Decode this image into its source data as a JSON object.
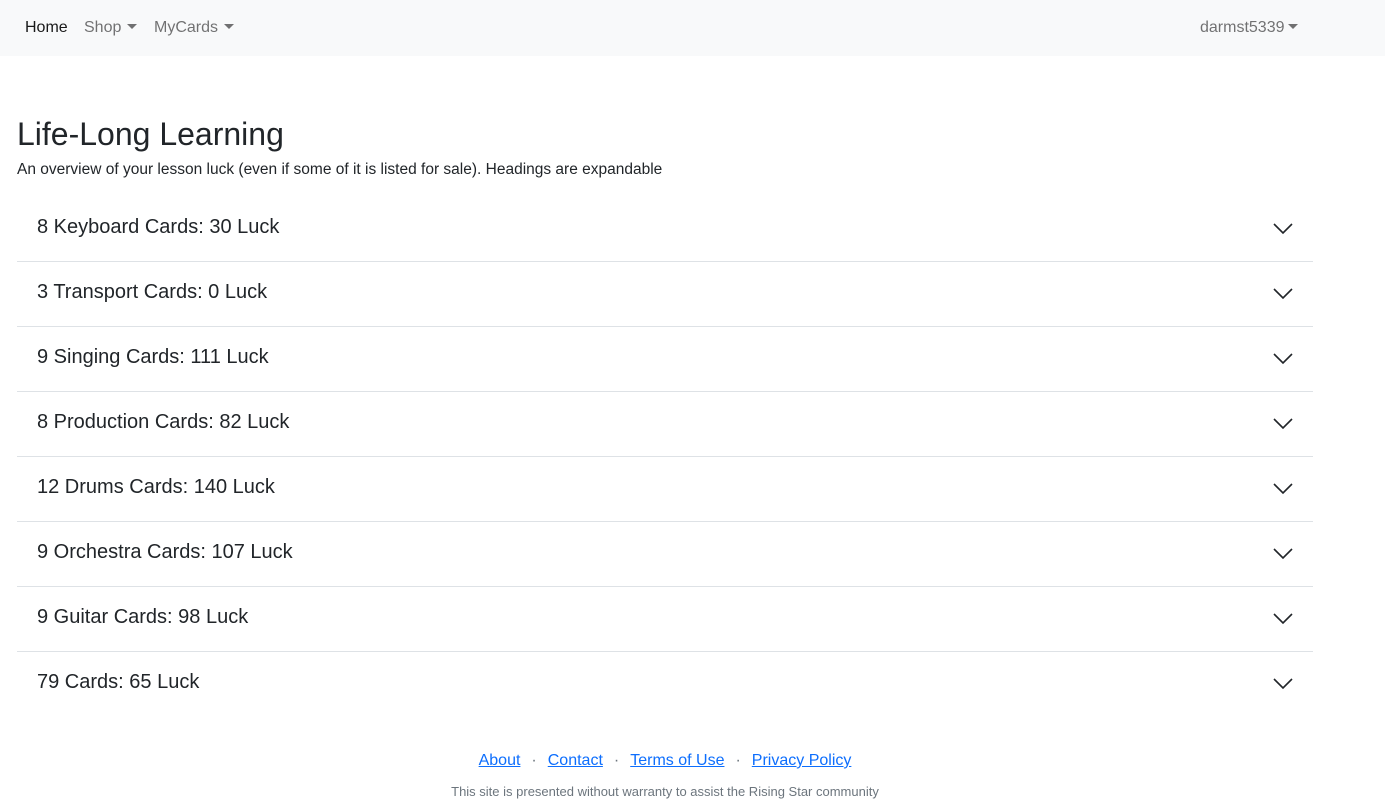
{
  "navbar": {
    "home_label": "Home",
    "shop_label": "Shop",
    "mycards_label": "MyCards",
    "user_label": "darmst5339"
  },
  "page": {
    "title": "Life-Long Learning",
    "subtitle": "An overview of your lesson luck (even if some of it is listed for sale). Headings are expandable"
  },
  "accordion": {
    "items": [
      {
        "label": "8 Keyboard Cards: 30 Luck"
      },
      {
        "label": "3 Transport Cards: 0 Luck"
      },
      {
        "label": "9 Singing Cards: 111 Luck"
      },
      {
        "label": "8 Production Cards: 82 Luck"
      },
      {
        "label": "12 Drums Cards: 140 Luck"
      },
      {
        "label": "9 Orchestra Cards: 107 Luck"
      },
      {
        "label": "9 Guitar Cards: 98 Luck"
      },
      {
        "label": "79 Cards: 65 Luck"
      }
    ],
    "expand_icon": "chevron-down-icon"
  },
  "footer": {
    "about": "About",
    "contact": "Contact",
    "terms": "Terms of Use",
    "privacy": "Privacy Policy",
    "separator": "·",
    "note": "This site is presented without warranty to assist the Rising Star community"
  },
  "colors": {
    "navbar_bg": "#f8f9fa",
    "link": "#0d6efd",
    "muted": "#6c757d",
    "divider": "#dee2e6"
  }
}
